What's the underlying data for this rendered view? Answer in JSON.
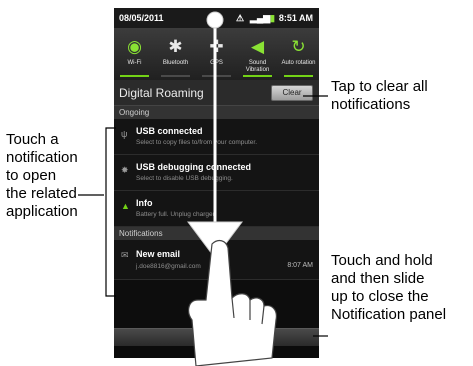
{
  "status_bar": {
    "date": "08/05/2011",
    "time": "8:51 AM",
    "icons": [
      "warning-icon",
      "signal-icon",
      "battery-icon"
    ]
  },
  "quick_settings": [
    {
      "label": "Wi-Fi",
      "icon": "wifi-icon",
      "on": true
    },
    {
      "label": "Bluetooth",
      "icon": "bluetooth-icon",
      "on": false
    },
    {
      "label": "GPS",
      "icon": "gps-icon",
      "on": false
    },
    {
      "label": "Sound Vibration",
      "icon": "sound-vibration-icon",
      "on": true
    },
    {
      "label": "Auto rotation",
      "icon": "rotation-icon",
      "on": true
    }
  ],
  "roaming": {
    "title": "Digital Roaming",
    "clear_label": "Clear"
  },
  "ongoing": {
    "header": "Ongoing",
    "items": [
      {
        "icon": "usb-icon",
        "title": "USB connected",
        "subtitle": "Select to copy files to/from your computer."
      },
      {
        "icon": "usb-debug-icon",
        "title": "USB debugging connected",
        "subtitle": "Select to disable USB debugging."
      },
      {
        "icon": "battery-info-icon",
        "title": "Info",
        "subtitle": "Battery full. Unplug charger"
      }
    ]
  },
  "notifications": {
    "header": "Notifications",
    "items": [
      {
        "icon": "email-icon",
        "title": "New email",
        "subtitle": "j.doe8816@gmail.com",
        "time": "8:07 AM"
      }
    ]
  },
  "callouts": {
    "clear": [
      "Tap to clear all",
      "notifications"
    ],
    "touch": [
      "Touch a",
      "notification",
      "to open",
      "the related",
      "application"
    ],
    "close": [
      "Touch and hold",
      "and then slide",
      "up to close the",
      "Notification panel"
    ]
  },
  "colors": {
    "toggle_on": "#73d216",
    "panel_bg": "#141414",
    "arrow": "#ffffff"
  }
}
